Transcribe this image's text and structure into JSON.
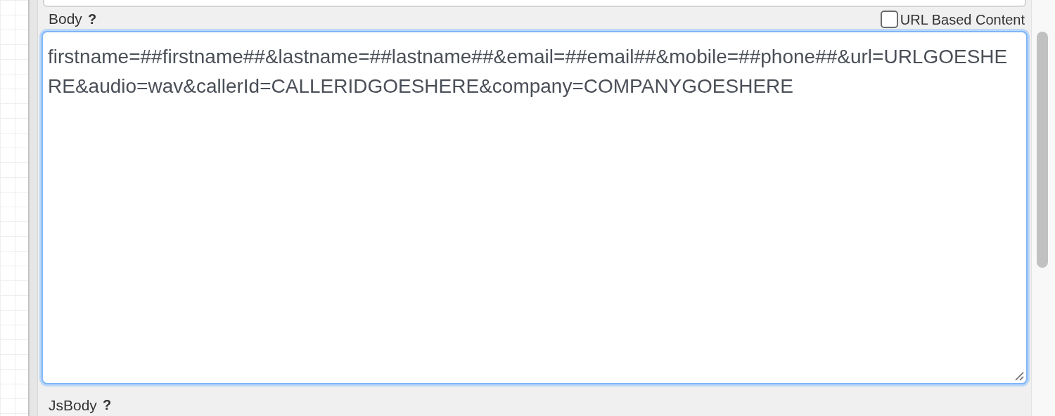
{
  "body": {
    "label": "Body",
    "help": "?",
    "url_based_content": {
      "label": "URL Based Content",
      "checked": false
    },
    "value": "firstname=##firstname##&lastname=##lastname##&email=##email##&mobile=##phone##&url=URLGOESHERE&audio=wav&callerId=CALLERIDGOESHERE&company=COMPANYGOESHERE",
    "focused": true
  },
  "jsbody": {
    "label": "JsBody",
    "help": "?"
  }
}
